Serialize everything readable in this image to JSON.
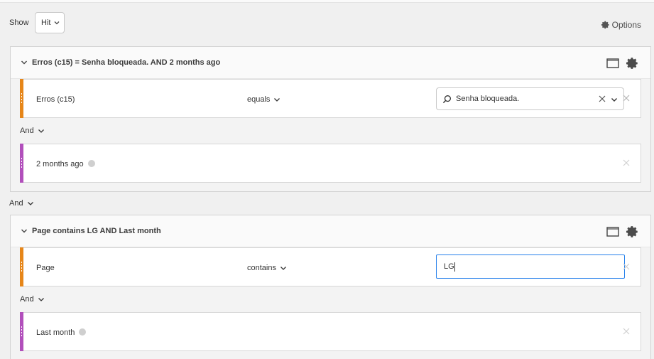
{
  "toolbar": {
    "show_label": "Show",
    "show_value": "Hit",
    "options_label": "Options"
  },
  "containers": [
    {
      "title": "Erros (c15) = Senha bloqueada. AND 2 months ago",
      "rules": [
        {
          "dimension": "Erros (c15)",
          "operator": "equals",
          "value": "Senha bloqueada.",
          "color": "#e68619"
        },
        {
          "dimension": "2 months ago",
          "color": "#b14fbb"
        }
      ],
      "inner_and": "And"
    },
    {
      "title": "Page contains LG AND Last month",
      "rules": [
        {
          "dimension": "Page",
          "operator": "contains",
          "value": "LG",
          "color": "#e68619"
        },
        {
          "dimension": "Last month",
          "color": "#b14fbb"
        }
      ],
      "inner_and": "And"
    }
  ],
  "between_and": "And",
  "icons": [
    "chevron-down-icon",
    "gear-icon",
    "container-icon",
    "search-icon",
    "close-icon",
    "info-icon"
  ]
}
